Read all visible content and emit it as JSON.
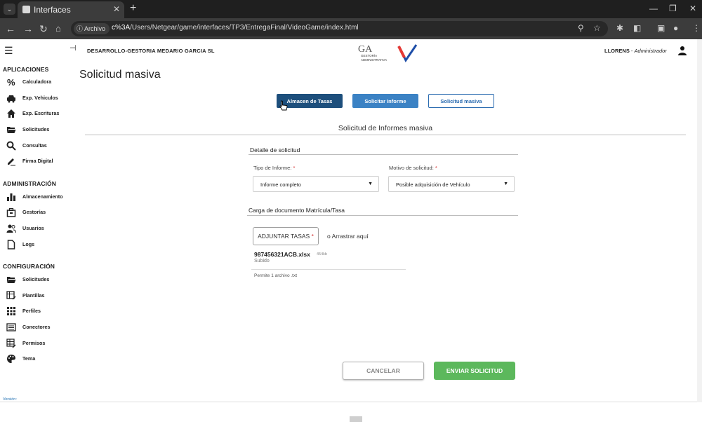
{
  "browser": {
    "tab_title": "Interfaces",
    "chip_label": "Archivo",
    "url_host": "c%3A",
    "url_path": "/Users/Netgear/game/interfaces/TP3/EntregaFinal/VideoGame/index.html"
  },
  "header": {
    "company": "DESARROLLO-GESTORIA MEDARIO GARCIA SL",
    "user_name": "LLORENS",
    "user_separator": " - ",
    "user_role": "Administrador",
    "logo_text_1": "GESTORÍA",
    "logo_text_2": "ADMINISTRATIVA",
    "logo_mark": "GA"
  },
  "sidebar": {
    "sections": [
      {
        "title": "APLICACIONES",
        "items": [
          {
            "label": "Calculadora",
            "icon": "percent-icon"
          },
          {
            "label": "Exp. Vehiculos",
            "icon": "car-icon"
          },
          {
            "label": "Exp. Escrituras",
            "icon": "home-icon"
          },
          {
            "label": "Solicitudes",
            "icon": "folder-icon"
          },
          {
            "label": "Consultas",
            "icon": "search-icon"
          },
          {
            "label": "Firma Digital",
            "icon": "signature-icon"
          }
        ]
      },
      {
        "title": "ADMINISTRACIÓN",
        "items": [
          {
            "label": "Almacenamiento",
            "icon": "bar-chart-icon"
          },
          {
            "label": "Gestorías",
            "icon": "building-icon"
          },
          {
            "label": "Usuarios",
            "icon": "users-icon"
          },
          {
            "label": "Logs",
            "icon": "document-icon"
          }
        ]
      },
      {
        "title": "CONFIGURACIÓN",
        "items": [
          {
            "label": "Solicitudes",
            "icon": "folder-icon"
          },
          {
            "label": "Plantillas",
            "icon": "template-icon"
          },
          {
            "label": "Perfiles",
            "icon": "grid-icon"
          },
          {
            "label": "Conectores",
            "icon": "list-icon"
          },
          {
            "label": "Permisos",
            "icon": "table-edit-icon"
          },
          {
            "label": "Tema",
            "icon": "palette-icon"
          }
        ]
      }
    ],
    "version_label": "Versión:"
  },
  "main": {
    "page_title": "Solicitud masiva",
    "tabs": [
      "Almacen de Tasas",
      "Solicitar Informe",
      "Solicitud masiva"
    ],
    "form_title": "Solicitud de Informes masiva",
    "detail_title": "Detalle de solicitud",
    "tipo_label": "Tipo de Informe:",
    "tipo_value": "Informe completo",
    "motivo_label": "Motivo de solicitud:",
    "motivo_value": "Posible adquisición de Vehículo",
    "required_mark": "*",
    "upload_title": "Carga de documento Matrícula/Tasa",
    "attach_label": "ADJUNTAR TASAS",
    "drag_text": "o Arrastrar aquí",
    "file_name": "987456321ACB.xlsx",
    "file_size": "454kb",
    "file_status": "Subido",
    "allow_text": "Permite 1 archivo .txt",
    "cancel_label": "CANCELAR",
    "send_label": "ENVIAR SOLICITUD"
  },
  "colors": {
    "tab_dark": "#1d4f7c",
    "tab_mid": "#3b82c4",
    "send_green": "#5cb85c",
    "required_red": "#d32f2f"
  }
}
